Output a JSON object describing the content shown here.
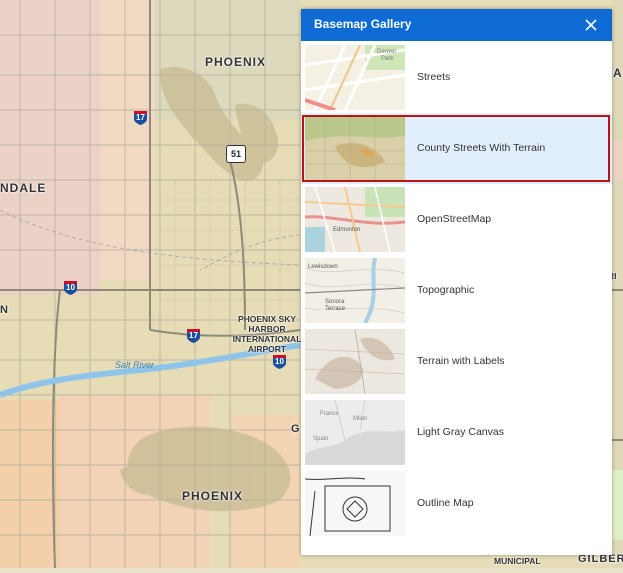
{
  "map": {
    "labels": {
      "phoenix_north": "PHOENIX",
      "phoenix_south": "PHOENIX",
      "glendale_partial": "NDALE",
      "west_partial": "N",
      "airport": "PHOENIX SKY HARBOR INTERNATIONAL AIRPORT",
      "salt_river": "Salt River",
      "gilbert_partial": "GILBER",
      "municipal": "MUNICIPAL",
      "east_partial": "RI",
      "g_partial": "G",
      "a_partial": "A"
    },
    "shields": {
      "i17_north": "17",
      "i10_west": "10",
      "i17_south": "17",
      "i10_east": "10",
      "sr51": "51"
    }
  },
  "gallery": {
    "title": "Basemap Gallery",
    "close_icon": "close-icon",
    "items": [
      {
        "label": "Streets",
        "thumb_icon": "streets-thumbnail"
      },
      {
        "label": "County Streets With Terrain",
        "thumb_icon": "county-streets-terrain-thumbnail",
        "selected": true
      },
      {
        "label": "OpenStreetMap",
        "thumb_icon": "openstreetmap-thumbnail"
      },
      {
        "label": "Topographic",
        "thumb_icon": "topographic-thumbnail"
      },
      {
        "label": "Terrain with Labels",
        "thumb_icon": "terrain-labels-thumbnail"
      },
      {
        "label": "Light Gray Canvas",
        "thumb_icon": "light-gray-canvas-thumbnail"
      },
      {
        "label": "Outline Map",
        "thumb_icon": "outline-map-thumbnail"
      }
    ],
    "thumb_text": {
      "streets_1": "Denver",
      "streets_2": "Park",
      "osm_1": "Edmonton",
      "topo_1": "Lewisdown",
      "topo_2": "Sonora",
      "topo_3": "Terrace",
      "gray_1": "Milan",
      "gray_2": "France",
      "gray_3": "Spain"
    }
  },
  "colors": {
    "header": "#0f6bd4",
    "selected_bg": "#e1eefb",
    "highlight_border": "#b81414",
    "interstate_blue": "#1a4fa0",
    "interstate_red": "#c8102e",
    "river": "#8fc4ea"
  }
}
